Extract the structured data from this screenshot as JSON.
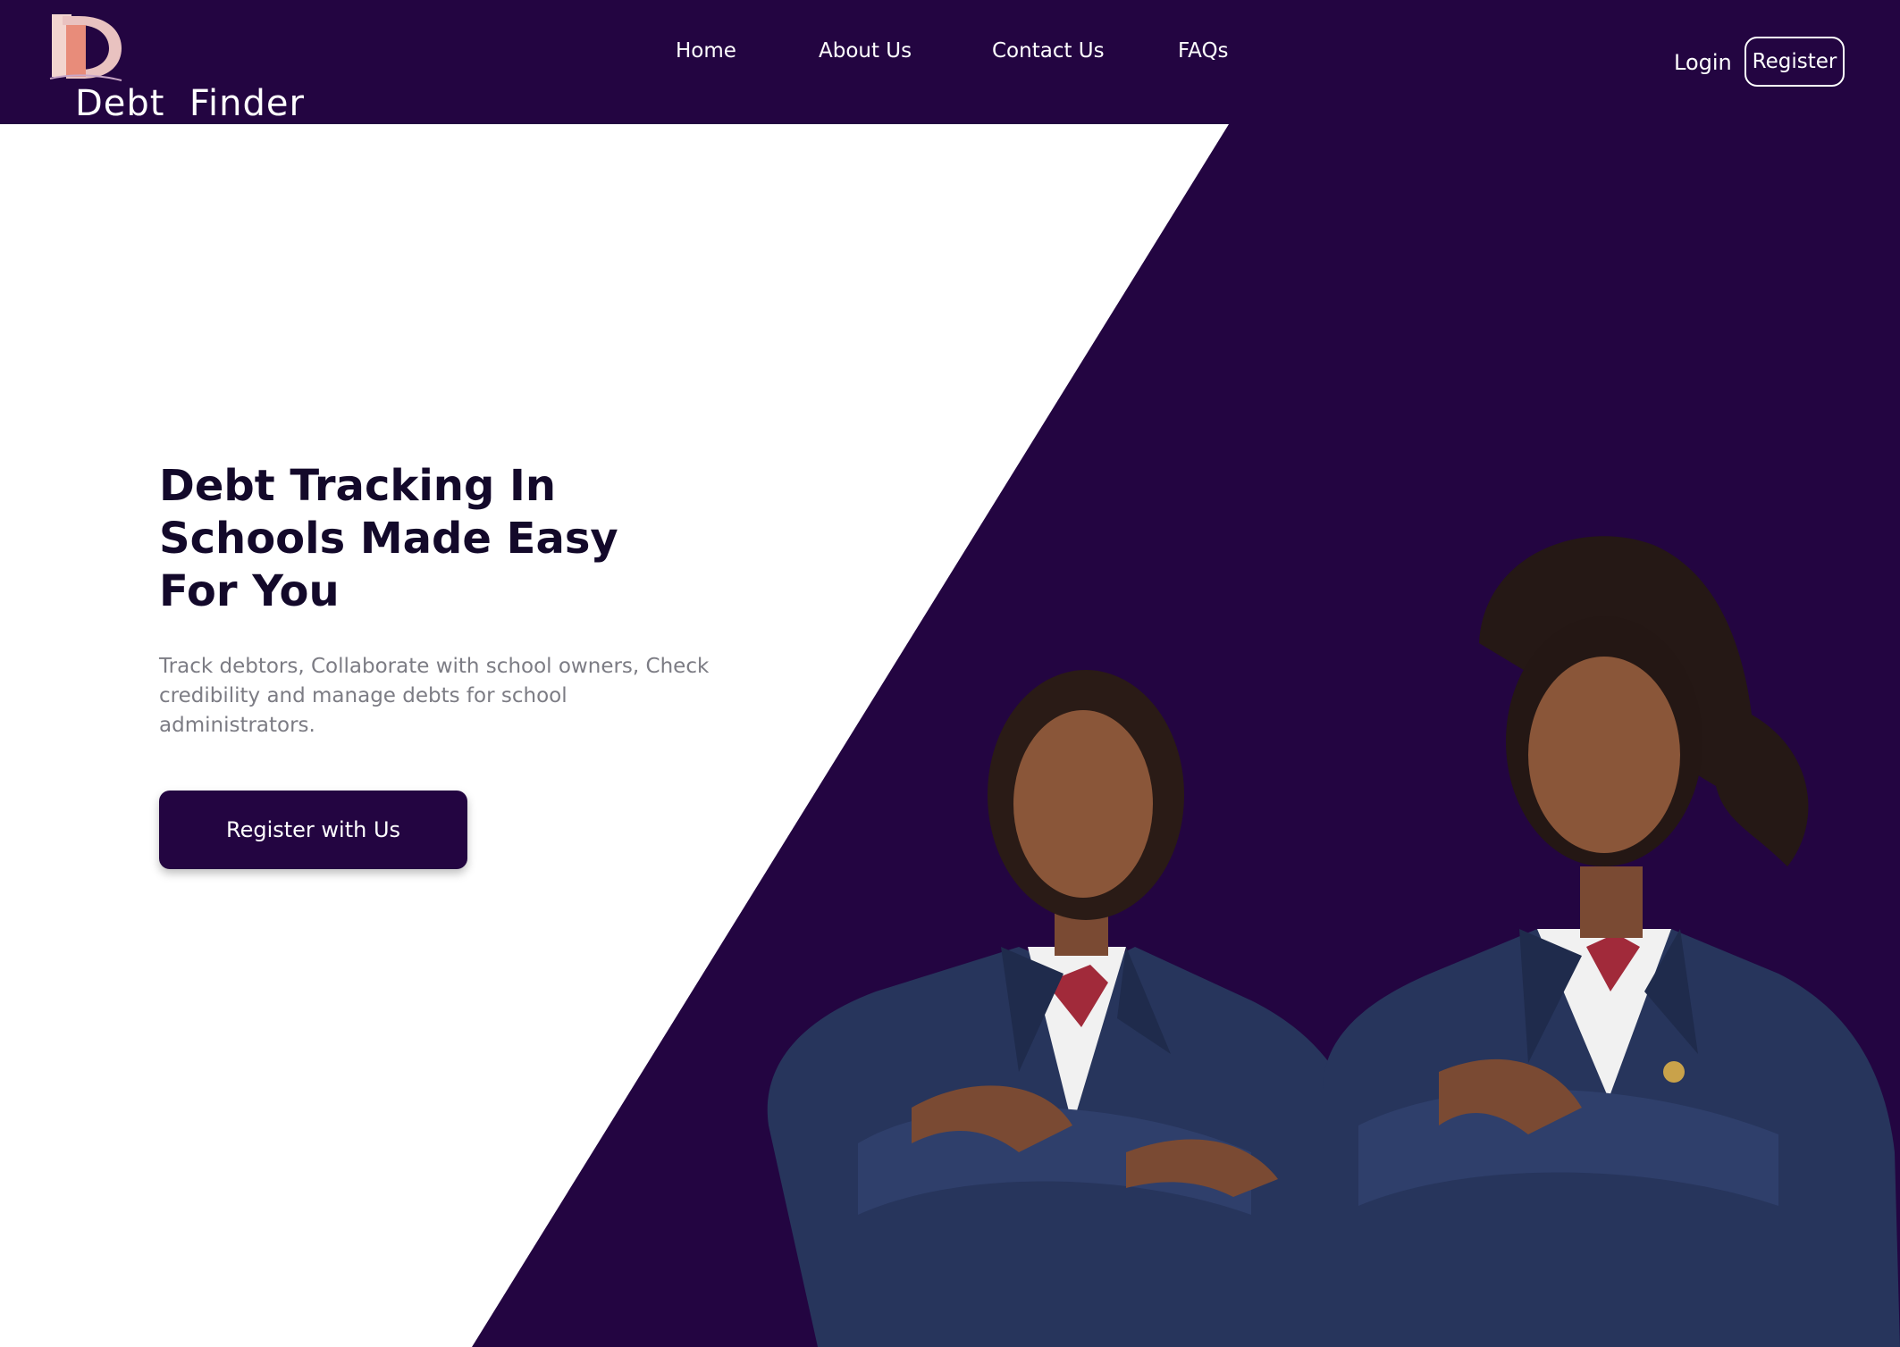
{
  "brand": {
    "name": "Debt  Finder",
    "colors": {
      "primary": "#230541",
      "white": "#ffffff",
      "heading": "#13092a",
      "muted": "#7c7c84"
    }
  },
  "nav": {
    "links": [
      {
        "label": "Home"
      },
      {
        "label": "About Us"
      },
      {
        "label": "Contact Us"
      },
      {
        "label": "FAQs"
      }
    ],
    "login_label": "Login",
    "register_label": "Register"
  },
  "hero": {
    "title_lines": [
      "Debt Tracking In",
      "Schools Made Easy",
      "For You"
    ],
    "subtitle_lines": [
      "Track debtors, Collaborate with school owners, Check",
      "credibility and manage debts for school administrators."
    ],
    "cta_label": "Register with Us"
  },
  "image": {
    "icon": "students-photo"
  }
}
